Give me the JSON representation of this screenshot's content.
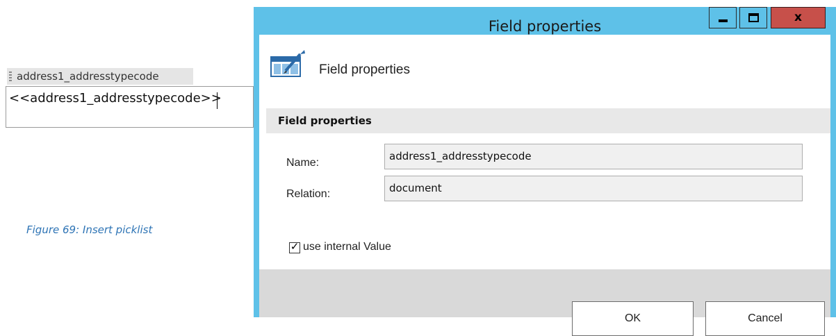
{
  "document": {
    "field_tag": "address1_addresstypecode",
    "merge_field": "<<address1_addresstypecode>>",
    "caption": "Figure 69: Insert picklist"
  },
  "window": {
    "title": "Field properties",
    "controls": {
      "minimize_icon": "minimize-icon",
      "maximize_icon": "maximize-icon",
      "close_label": "x"
    },
    "accent_color": "#5ec1e8",
    "close_color": "#c7504a"
  },
  "dialog": {
    "header_title": "Field properties",
    "header_icon": "table-edit-icon",
    "section_title": "Field properties",
    "fields": [
      {
        "label": "Name:",
        "value": "address1_addresstypecode"
      },
      {
        "label": "Relation:",
        "value": "document"
      }
    ],
    "checkbox": {
      "label": "use internal Value",
      "checked": true,
      "mark": "✓"
    },
    "buttons": {
      "ok": "OK",
      "cancel": "Cancel"
    }
  }
}
